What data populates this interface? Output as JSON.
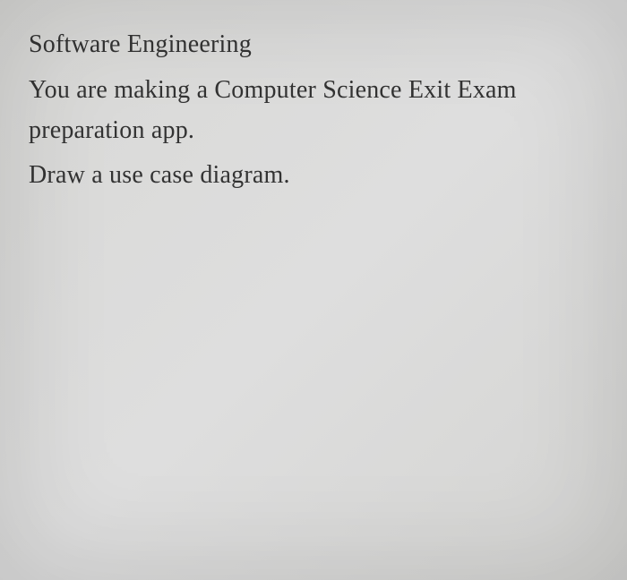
{
  "document": {
    "title": "Software Engineering",
    "body_line_1": "You are making a Computer Science Exit Exam",
    "body_line_2": "preparation app.",
    "instruction": "Draw a use case diagram."
  }
}
